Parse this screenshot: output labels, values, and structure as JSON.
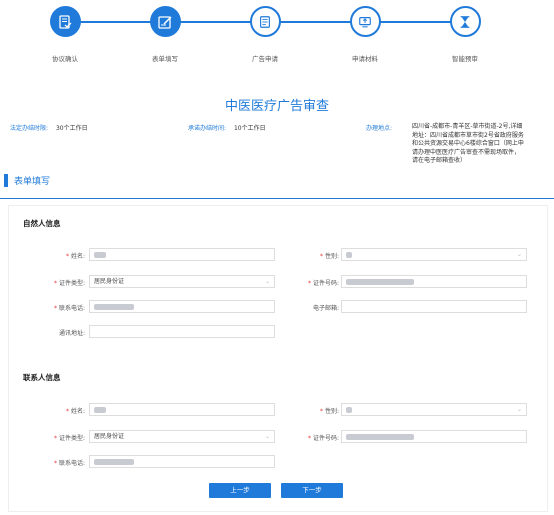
{
  "steps": [
    {
      "label": "协议确认"
    },
    {
      "label": "表单填写"
    },
    {
      "label": "广告申请"
    },
    {
      "label": "申请材料"
    },
    {
      "label": "智能预审"
    }
  ],
  "title": "中医医疗广告审查",
  "meta": {
    "legal_label": "法定办结时限:",
    "legal_value": "30个工作日",
    "promise_label": "承诺办结时间:",
    "promise_value": "10个工作日",
    "place_label": "办理地点:",
    "place_value": "四川省-成都市-青羊区-草市街道-2号,详细地址：四川省成都市草市街2号省政府服务和公共资源交易中心6楼综合窗口（网上申请办理中医医疗广告审查不需现场取件，请在电子邮箱查收）"
  },
  "section_title": "表单填写",
  "natural": {
    "title": "自然人信息",
    "name_label": "姓名:",
    "gender_label": "性别:",
    "idtype_label": "证件类型:",
    "idtype_value": "居民身份证",
    "idno_label": "证件号码:",
    "phone_label": "联系电话:",
    "email_label": "电子邮箱:",
    "address_label": "通讯地址:"
  },
  "contact": {
    "title": "联系人信息",
    "name_label": "姓名:",
    "gender_label": "性别:",
    "idtype_label": "证件类型:",
    "idtype_value": "居民身份证",
    "idno_label": "证件号码:",
    "phone_label": "联系电话:"
  },
  "buttons": {
    "prev": "上一步",
    "next": "下一步"
  },
  "colors": {
    "accent": "#1f7ad9",
    "required": "#e33"
  }
}
